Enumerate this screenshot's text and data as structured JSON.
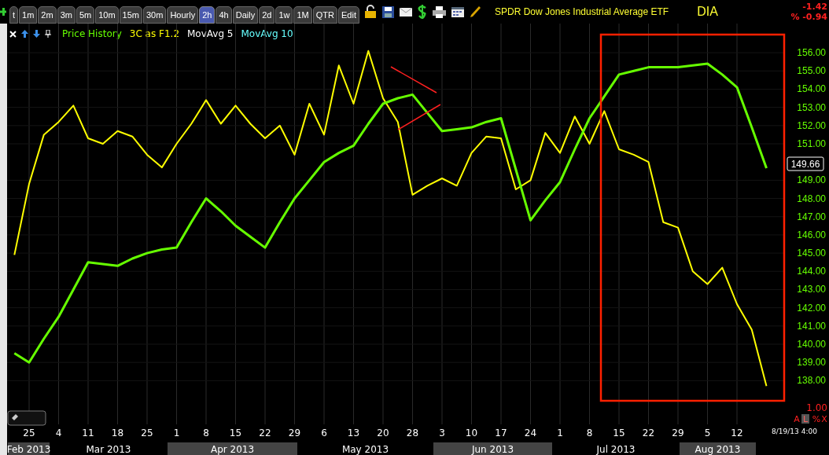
{
  "toolbar": {
    "tabs": [
      {
        "label": "t",
        "selected": false
      },
      {
        "label": "1m",
        "selected": false
      },
      {
        "label": "2m",
        "selected": false
      },
      {
        "label": "3m",
        "selected": false
      },
      {
        "label": "5m",
        "selected": false
      },
      {
        "label": "10m",
        "selected": false
      },
      {
        "label": "15m",
        "selected": false
      },
      {
        "label": "30m",
        "selected": false
      },
      {
        "label": "Hourly",
        "selected": false
      },
      {
        "label": "2h",
        "selected": true
      },
      {
        "label": "4h",
        "selected": false
      },
      {
        "label": "Daily",
        "selected": false
      },
      {
        "label": "2d",
        "selected": false
      },
      {
        "label": "1w",
        "selected": false
      },
      {
        "label": "1M",
        "selected": false
      },
      {
        "label": "QTR",
        "selected": false
      },
      {
        "label": "Edit",
        "selected": false
      }
    ],
    "title": "SPDR Dow Jones Industrial Average ETF",
    "symbol": "DIA",
    "change": "-1.42",
    "change_percent": "% -0.94"
  },
  "legend": [
    {
      "label": "MovAvg 5",
      "color": "#ffffff"
    },
    {
      "label": "MovAvg 10",
      "color": "#66ffff"
    }
  ],
  "chart": {
    "chart_data": {
      "type": "line",
      "grid": true,
      "categories": [
        null,
        "25",
        null,
        "4",
        null,
        "11",
        null,
        "18",
        null,
        "25",
        null,
        "1",
        null,
        "8",
        null,
        "15",
        null,
        "22",
        null,
        "29",
        null,
        "6",
        null,
        "13",
        null,
        "20",
        null,
        "28",
        null,
        "3",
        null,
        "10",
        null,
        "17",
        null,
        "24",
        null,
        "1",
        null,
        "8",
        null,
        "15",
        null,
        "22",
        null,
        "29",
        null,
        "5",
        null,
        "12",
        null,
        null
      ],
      "ylim": [
        135.6,
        157.6
      ],
      "series": [
        {
          "name": "Price History",
          "color": "#66ff00",
          "values": [
            139.5,
            139.0,
            140.3,
            141.5,
            143.0,
            144.5,
            144.4,
            144.3,
            144.7,
            145.0,
            145.2,
            145.3,
            146.7,
            148.0,
            147.3,
            146.5,
            145.9,
            145.3,
            146.7,
            148.0,
            149.0,
            150.0,
            150.5,
            150.9,
            152.1,
            153.2,
            153.5,
            153.7,
            152.7,
            151.7,
            151.8,
            151.9,
            152.2,
            152.4,
            149.6,
            146.8,
            147.9,
            148.9,
            150.7,
            152.4,
            153.6,
            154.8,
            155.0,
            155.2,
            155.2,
            155.2,
            155.3,
            155.4,
            154.8,
            154.1,
            151.9,
            149.66
          ]
        },
        {
          "name": "3C as F1.2",
          "color": "#ffff00",
          "values": [
            144.9,
            148.8,
            151.5,
            152.2,
            153.1,
            151.3,
            151.0,
            151.7,
            151.4,
            150.4,
            149.7,
            151.0,
            152.1,
            153.4,
            152.1,
            153.1,
            152.1,
            151.3,
            152.0,
            150.4,
            153.2,
            151.5,
            155.3,
            153.2,
            156.1,
            153.5,
            152.2,
            148.2,
            148.7,
            149.1,
            148.7,
            150.5,
            151.4,
            151.3,
            148.5,
            149.0,
            151.6,
            150.5,
            152.5,
            151.0,
            152.8,
            150.7,
            150.4,
            150.0,
            146.7,
            146.4,
            144.0,
            143.3,
            144.2,
            142.2,
            140.8,
            137.7
          ]
        }
      ],
      "yticks": [
        {
          "value": 156,
          "label": "156.00"
        },
        {
          "value": 155,
          "label": "155.00"
        },
        {
          "value": 154,
          "label": "154.00"
        },
        {
          "value": 153,
          "label": "153.00"
        },
        {
          "value": 152,
          "label": "152.00"
        },
        {
          "value": 151,
          "label": "151.00"
        },
        {
          "value": 149,
          "label": "149.00"
        },
        {
          "value": 148,
          "label": "148.00"
        },
        {
          "value": 147,
          "label": "147.00"
        },
        {
          "value": 146,
          "label": "146.00"
        },
        {
          "value": 145,
          "label": "145.00"
        },
        {
          "value": 144,
          "label": "144.00"
        },
        {
          "value": 143,
          "label": "143.00"
        },
        {
          "value": 142,
          "label": "142.00"
        },
        {
          "value": 141,
          "label": "141.00"
        },
        {
          "value": 140,
          "label": "140.00"
        },
        {
          "value": 139,
          "label": "139.00"
        },
        {
          "value": 138,
          "label": "138.00"
        }
      ]
    },
    "last_price": "149.66",
    "scale": "1.00",
    "scale_buttons": [
      {
        "label": "A",
        "selected": false
      },
      {
        "label": "L",
        "selected": true
      },
      {
        "label": "%",
        "selected": false
      },
      {
        "label": "X",
        "selected": false
      }
    ],
    "timestamp": "8/19/13 4:00",
    "months": [
      {
        "label": "Feb 2013",
        "shaded": true
      },
      {
        "label": "Mar 2013",
        "shaded": false
      },
      {
        "label": "Apr 2013",
        "shaded": true
      },
      {
        "label": "May 2013",
        "shaded": false
      },
      {
        "label": "Jun 2013",
        "shaded": true
      },
      {
        "label": "Jul 2013",
        "shaded": false
      },
      {
        "label": "Aug 2013",
        "shaded": true
      }
    ]
  }
}
